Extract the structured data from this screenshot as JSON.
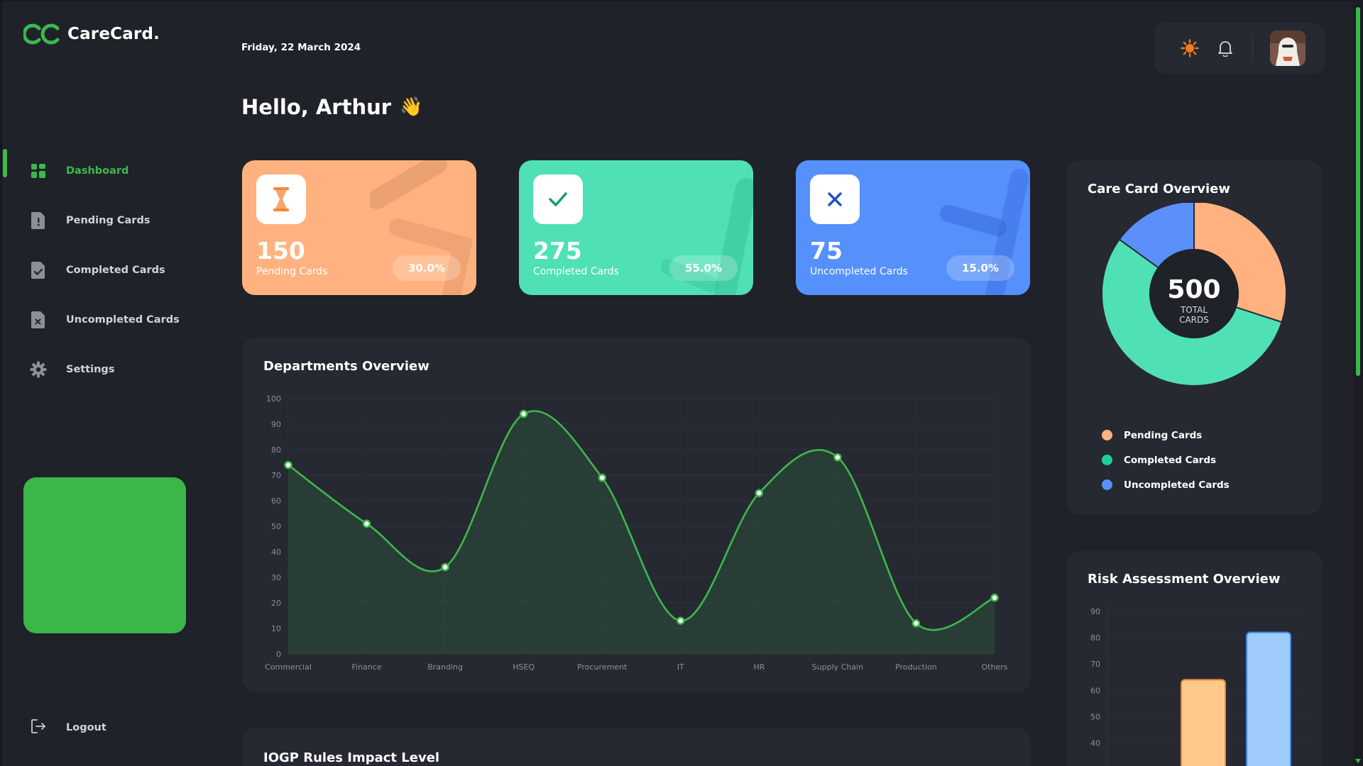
{
  "app": {
    "name": "CareCard."
  },
  "sidebar": {
    "items": [
      {
        "label": "Dashboard",
        "icon": "dashboard-icon",
        "active": true
      },
      {
        "label": "Pending Cards",
        "icon": "pending-file-icon",
        "active": false
      },
      {
        "label": "Completed Cards",
        "icon": "completed-file-icon",
        "active": false
      },
      {
        "label": "Uncompleted Cards",
        "icon": "uncompleted-file-icon",
        "active": false
      },
      {
        "label": "Settings",
        "icon": "gear-icon",
        "active": false
      }
    ],
    "logout_label": "Logout"
  },
  "header": {
    "date": "Friday, 22 March 2024",
    "greeting": "Hello, Arthur",
    "greeting_emoji": "👋"
  },
  "stats": {
    "pending": {
      "value": "150",
      "label": "Pending Cards",
      "percent": "30.0%",
      "color": "#ffb27f",
      "icon": "hourglass-icon"
    },
    "completed": {
      "value": "275",
      "label": "Completed Cards",
      "percent": "55.0%",
      "color": "#4fe0b6",
      "icon": "check-icon"
    },
    "uncompleted": {
      "value": "75",
      "label": "Uncompleted Cards",
      "percent": "15.0%",
      "color": "#5590fb",
      "icon": "close-icon"
    }
  },
  "departments": {
    "title": "Departments Overview"
  },
  "iogp": {
    "title": "IOGP Rules Impact Level"
  },
  "overview": {
    "title": "Care Card Overview",
    "total_value": "500",
    "total_label_1": "TOTAL",
    "total_label_2": "CARDS",
    "legend": [
      {
        "label": "Pending Cards",
        "color": "#ffb27f"
      },
      {
        "label": "Completed Cards",
        "color": "#1fcf9a"
      },
      {
        "label": "Uncompleted Cards",
        "color": "#5b8ff9"
      }
    ]
  },
  "risk": {
    "title": "Risk Assessment Overview"
  },
  "chart_data": [
    {
      "type": "area",
      "title": "Departments Overview",
      "categories": [
        "Commercial",
        "Finance",
        "Branding",
        "HSEQ",
        "Procurement",
        "IT",
        "HR",
        "Supply Chain",
        "Production",
        "Others"
      ],
      "values": [
        74,
        51,
        34,
        94,
        69,
        13,
        63,
        77,
        12,
        22
      ],
      "ylim": [
        0,
        100
      ],
      "yticks": [
        0,
        10,
        20,
        30,
        40,
        50,
        60,
        70,
        80,
        90,
        100
      ],
      "color": "#3cb94b",
      "grid": true
    },
    {
      "type": "pie",
      "title": "Care Card Overview",
      "labels": [
        "Pending Cards",
        "Completed Cards",
        "Uncompleted Cards"
      ],
      "values": [
        150,
        275,
        75
      ],
      "colors": [
        "#ffb27f",
        "#4fe0b6",
        "#5b8ff9"
      ]
    },
    {
      "type": "bar",
      "title": "Risk Assessment Overview",
      "values": [
        64,
        82
      ],
      "colors": [
        "#ffc98b",
        "#9ecbfa"
      ],
      "ylim": [
        35,
        90
      ],
      "yticks": [
        40,
        50,
        60,
        70,
        80,
        90
      ],
      "grid": true
    }
  ]
}
